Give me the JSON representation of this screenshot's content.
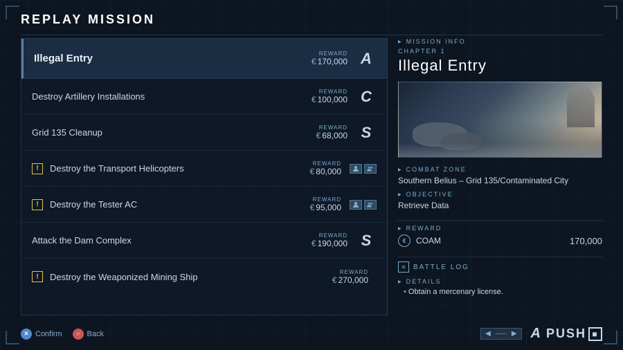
{
  "page": {
    "title": "REPLAY MISSION"
  },
  "missions": [
    {
      "id": "illegal-entry",
      "name": "Illegal Entry",
      "reward": "170,000",
      "rank": "A",
      "selected": true,
      "chapter": true,
      "hasWarning": false,
      "hasCoop": false
    },
    {
      "id": "destroy-artillery",
      "name": "Destroy Artillery Installations",
      "reward": "100,000",
      "rank": "C",
      "selected": false,
      "chapter": false,
      "hasWarning": false,
      "hasCoop": false
    },
    {
      "id": "grid-135",
      "name": "Grid 135 Cleanup",
      "reward": "68,000",
      "rank": "S",
      "selected": false,
      "chapter": false,
      "hasWarning": false,
      "hasCoop": false
    },
    {
      "id": "destroy-transport",
      "name": "Destroy the Transport Helicopters",
      "reward": "80,000",
      "rank": "",
      "selected": false,
      "chapter": false,
      "hasWarning": true,
      "hasCoop": true
    },
    {
      "id": "destroy-tester",
      "name": "Destroy the Tester AC",
      "reward": "95,000",
      "rank": "",
      "selected": false,
      "chapter": false,
      "hasWarning": true,
      "hasCoop": true
    },
    {
      "id": "attack-dam",
      "name": "Attack the Dam Complex",
      "reward": "190,000",
      "rank": "S",
      "selected": false,
      "chapter": false,
      "hasWarning": false,
      "hasCoop": true
    },
    {
      "id": "destroy-mining",
      "name": "Destroy the Weaponized Mining Ship",
      "reward": "270,000",
      "rank": "",
      "selected": false,
      "chapter": false,
      "hasWarning": true,
      "hasCoop": false
    }
  ],
  "mission_info": {
    "section_label": "MISSION INFO",
    "chapter_label": "CHAPTER 1",
    "title": "Illegal Entry",
    "combat_zone_label": "COMBAT ZONE",
    "combat_zone": "Southern Belius – Grid 135/Contaminated City",
    "objective_label": "OBJECTIVE",
    "objective": "Retrieve Data",
    "reward_label": "REWARD",
    "currency_icon": "€",
    "currency_label": "COAM",
    "reward_amount": "170,000",
    "battle_log_label": "BATTLE LOG",
    "details_label": "DETAILS",
    "detail_item": "Obtain a mercenary license."
  },
  "controls": {
    "confirm_label": "Confirm",
    "back_label": "Back",
    "confirm_btn": "✕",
    "back_btn": "○"
  },
  "bottom_right": {
    "nav_rank": "A",
    "brand": "PUSH"
  },
  "reward_label": "REWARD",
  "currency_symbol": "€"
}
